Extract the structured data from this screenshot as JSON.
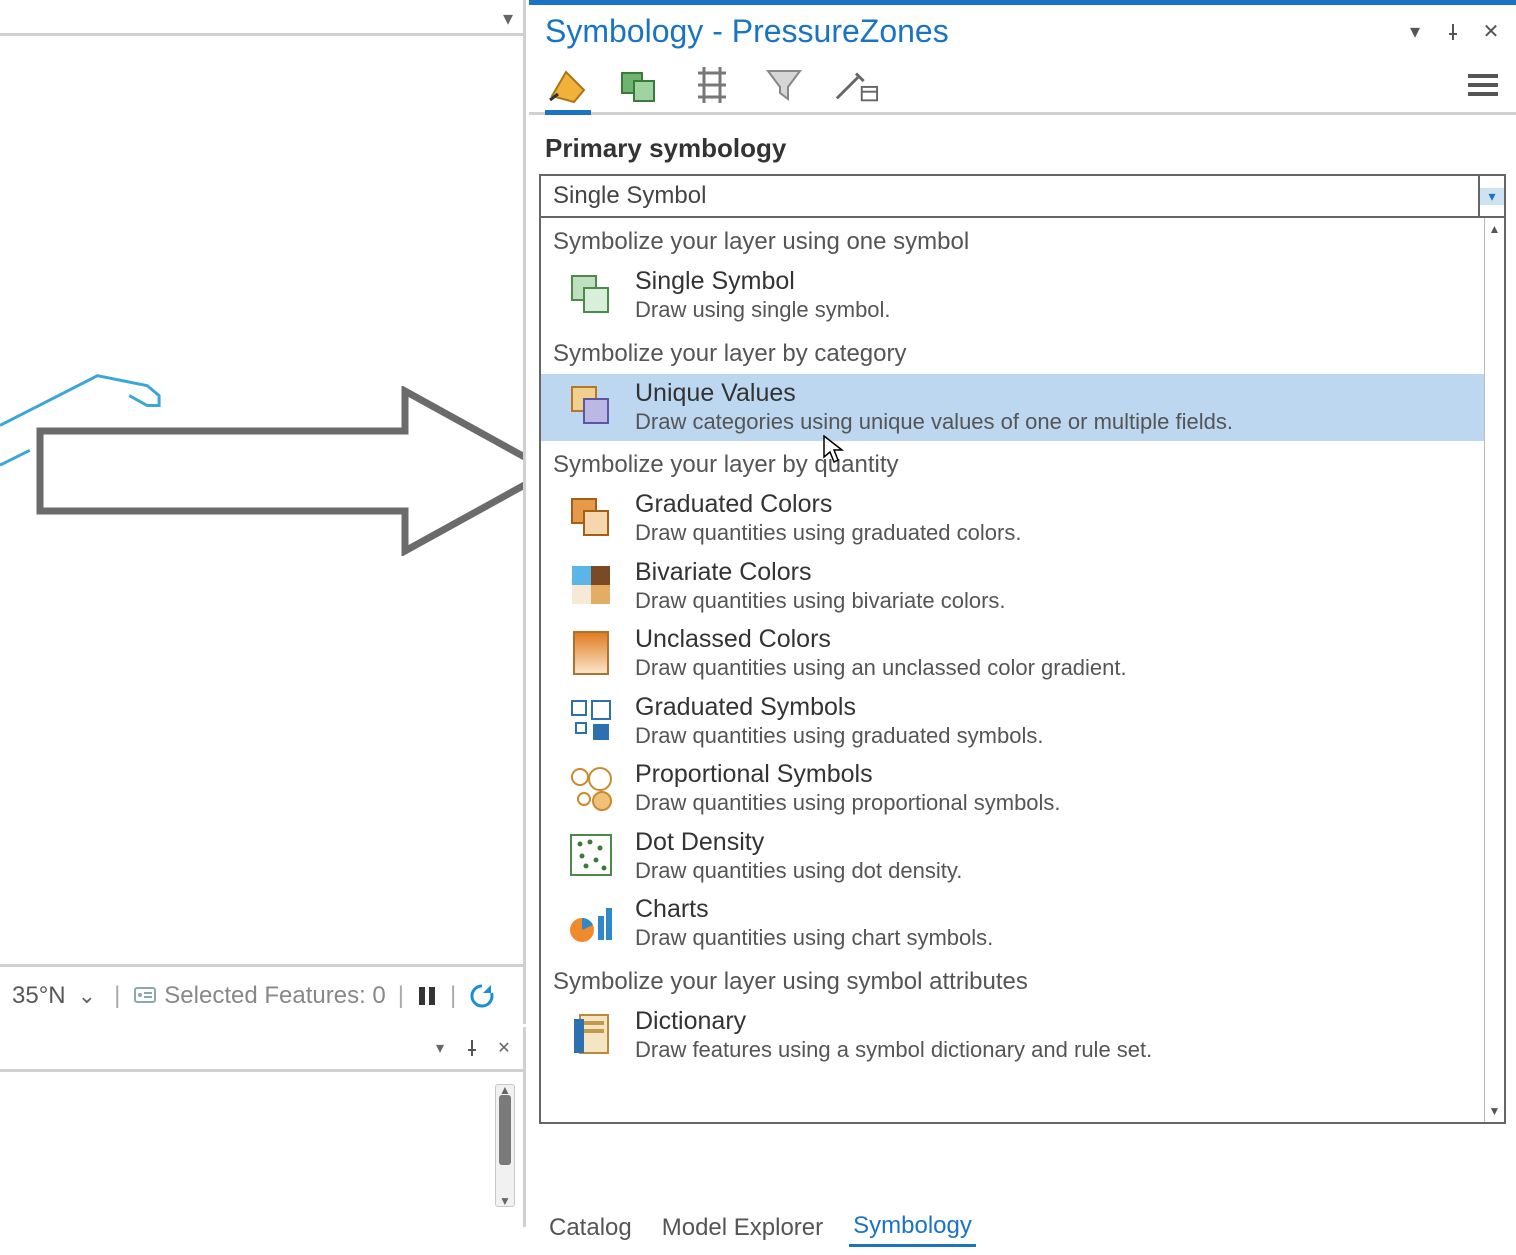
{
  "panel": {
    "title": "Symbology - PressureZones"
  },
  "section_title": "Primary symbology",
  "dropdown_value": "Single Symbol",
  "groups": [
    {
      "header": "Symbolize your layer using one symbol",
      "items": [
        {
          "id": "single-symbol",
          "title": "Single Symbol",
          "desc": "Draw using single symbol."
        }
      ]
    },
    {
      "header": "Symbolize your layer by category",
      "items": [
        {
          "id": "unique-values",
          "title": "Unique Values",
          "desc": "Draw categories using unique values of one or multiple fields.",
          "highlight": true
        }
      ]
    },
    {
      "header": "Symbolize your layer by quantity",
      "items": [
        {
          "id": "graduated-colors",
          "title": "Graduated Colors",
          "desc": "Draw quantities using graduated colors."
        },
        {
          "id": "bivariate-colors",
          "title": "Bivariate Colors",
          "desc": "Draw quantities using bivariate colors."
        },
        {
          "id": "unclassed-colors",
          "title": "Unclassed Colors",
          "desc": "Draw quantities using an unclassed color gradient."
        },
        {
          "id": "graduated-symbols",
          "title": "Graduated Symbols",
          "desc": "Draw quantities using graduated symbols."
        },
        {
          "id": "proportional-symbols",
          "title": "Proportional Symbols",
          "desc": "Draw quantities using proportional symbols."
        },
        {
          "id": "dot-density",
          "title": "Dot Density",
          "desc": "Draw quantities using dot density."
        },
        {
          "id": "charts",
          "title": "Charts",
          "desc": "Draw quantities using chart symbols."
        }
      ]
    },
    {
      "header": "Symbolize your layer using symbol attributes",
      "items": [
        {
          "id": "dictionary",
          "title": "Dictionary",
          "desc": "Draw features using a symbol dictionary and rule set."
        }
      ]
    }
  ],
  "footer_tabs": {
    "catalog": "Catalog",
    "model_explorer": "Model Explorer",
    "symbology": "Symbology"
  },
  "statusbar": {
    "coord_fragment": "35°N",
    "selected_features_label": "Selected Features: 0"
  }
}
